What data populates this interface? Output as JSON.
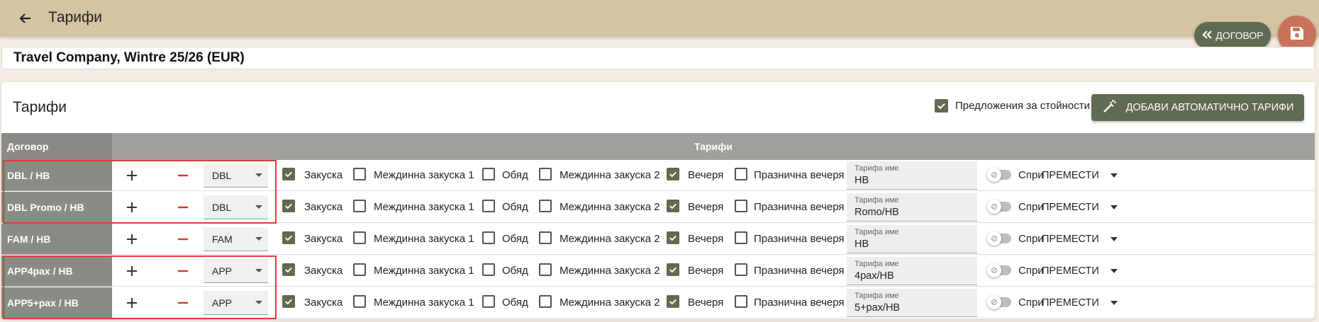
{
  "header": {
    "title": "Тарифи",
    "contract_button": "ДОГОВОР"
  },
  "contract_name": "Travel Company, Wintre 25/26 (EUR)",
  "card": {
    "title": "Тарифи",
    "offers_label": "Предложения за стойности",
    "offers_checked": true,
    "auto_button": "ДОБАВИ АВТОМАТИЧНО ТАРИФИ"
  },
  "table": {
    "col_contract": "Договор",
    "col_rates": "Тарифи",
    "meals": [
      "Закуска",
      "Междинна закуска 1",
      "Обяд",
      "Междинна закуска 2",
      "Вечеря",
      "Празнична вечеря"
    ],
    "rate_name_label": "Тарифа име",
    "stop_label": "Спри",
    "move_label": "ПРЕМЕСТИ",
    "rows": [
      {
        "label": "DBL / HB",
        "room": "DBL",
        "rate_name": "HB",
        "meals_checked": [
          true,
          false,
          false,
          false,
          true,
          false
        ]
      },
      {
        "label": "DBL Promo / HB",
        "room": "DBL",
        "rate_name": "Romo/HB",
        "meals_checked": [
          true,
          false,
          false,
          false,
          true,
          false
        ]
      },
      {
        "label": "FAM / HB",
        "room": "FAM",
        "rate_name": "HB",
        "meals_checked": [
          true,
          false,
          false,
          false,
          true,
          false
        ]
      },
      {
        "label": "APP4pax / HB",
        "room": "APP",
        "rate_name": "4pax/HB",
        "meals_checked": [
          true,
          false,
          false,
          false,
          true,
          false
        ]
      },
      {
        "label": "APP5+pax / HB",
        "room": "APP",
        "rate_name": "5+pax/HB",
        "meals_checked": [
          true,
          false,
          false,
          false,
          true,
          false
        ]
      }
    ]
  },
  "colors": {
    "accent": "#5f6b52",
    "save": "#c8735e",
    "topbar": "#d3c4a2",
    "highlight": "#e03c3c"
  }
}
